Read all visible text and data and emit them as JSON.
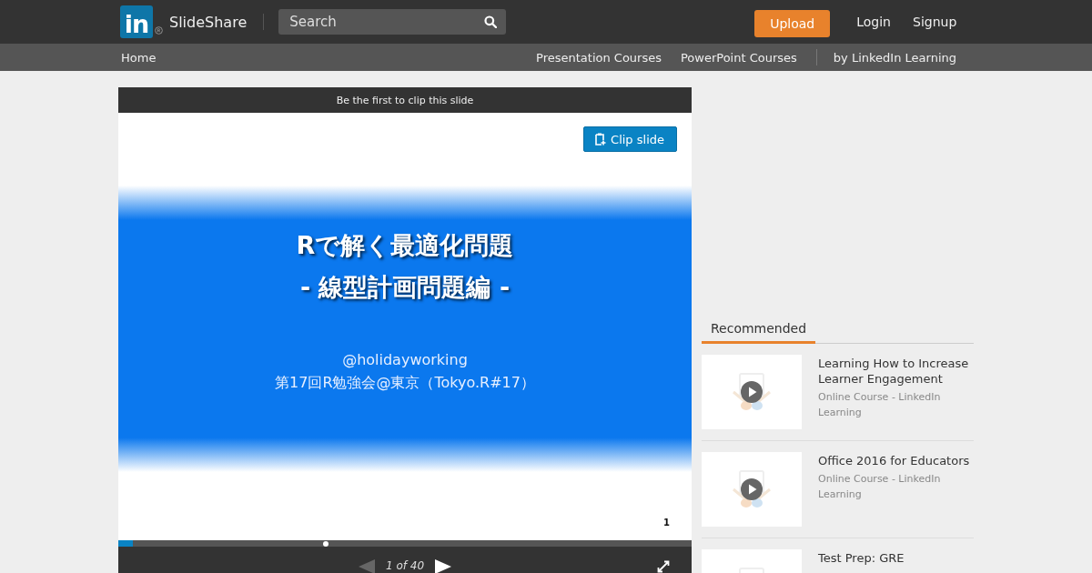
{
  "header": {
    "logo_text": "in",
    "brand": "SlideShare",
    "search": {
      "placeholder": "Search"
    },
    "upload": "Upload",
    "links": [
      "Login",
      "Signup"
    ]
  },
  "subnav": {
    "home": "Home",
    "links": [
      "Presentation Courses",
      "PowerPoint Courses"
    ],
    "partner": "by LinkedIn Learning"
  },
  "player": {
    "clip_banner": "Be the first to clip this slide",
    "clip_button": "Clip slide",
    "slide": {
      "title_lines": [
        "Rで解く最適化問題",
        "- 線型計画問題編 -"
      ],
      "author": "@holidayworking",
      "event": "第17回R勉強会@東京（Tokyo.R#17）",
      "page_number": "1"
    },
    "progress": {
      "level": 0.025
    },
    "counter": "1 of 40",
    "prev": {
      "disabled": true
    },
    "next": {
      "disabled": false
    }
  },
  "sidebar": {
    "tabs": [
      {
        "label": "Recommended",
        "selected": true
      }
    ],
    "items": [
      {
        "title": "Learning How to Increase Learner Engagement",
        "subtitle": "Online Course - LinkedIn Learning"
      },
      {
        "title": "Office 2016 for Educators",
        "subtitle": "Online Course - LinkedIn Learning"
      },
      {
        "title": "Test Prep: GRE"
      }
    ]
  }
}
